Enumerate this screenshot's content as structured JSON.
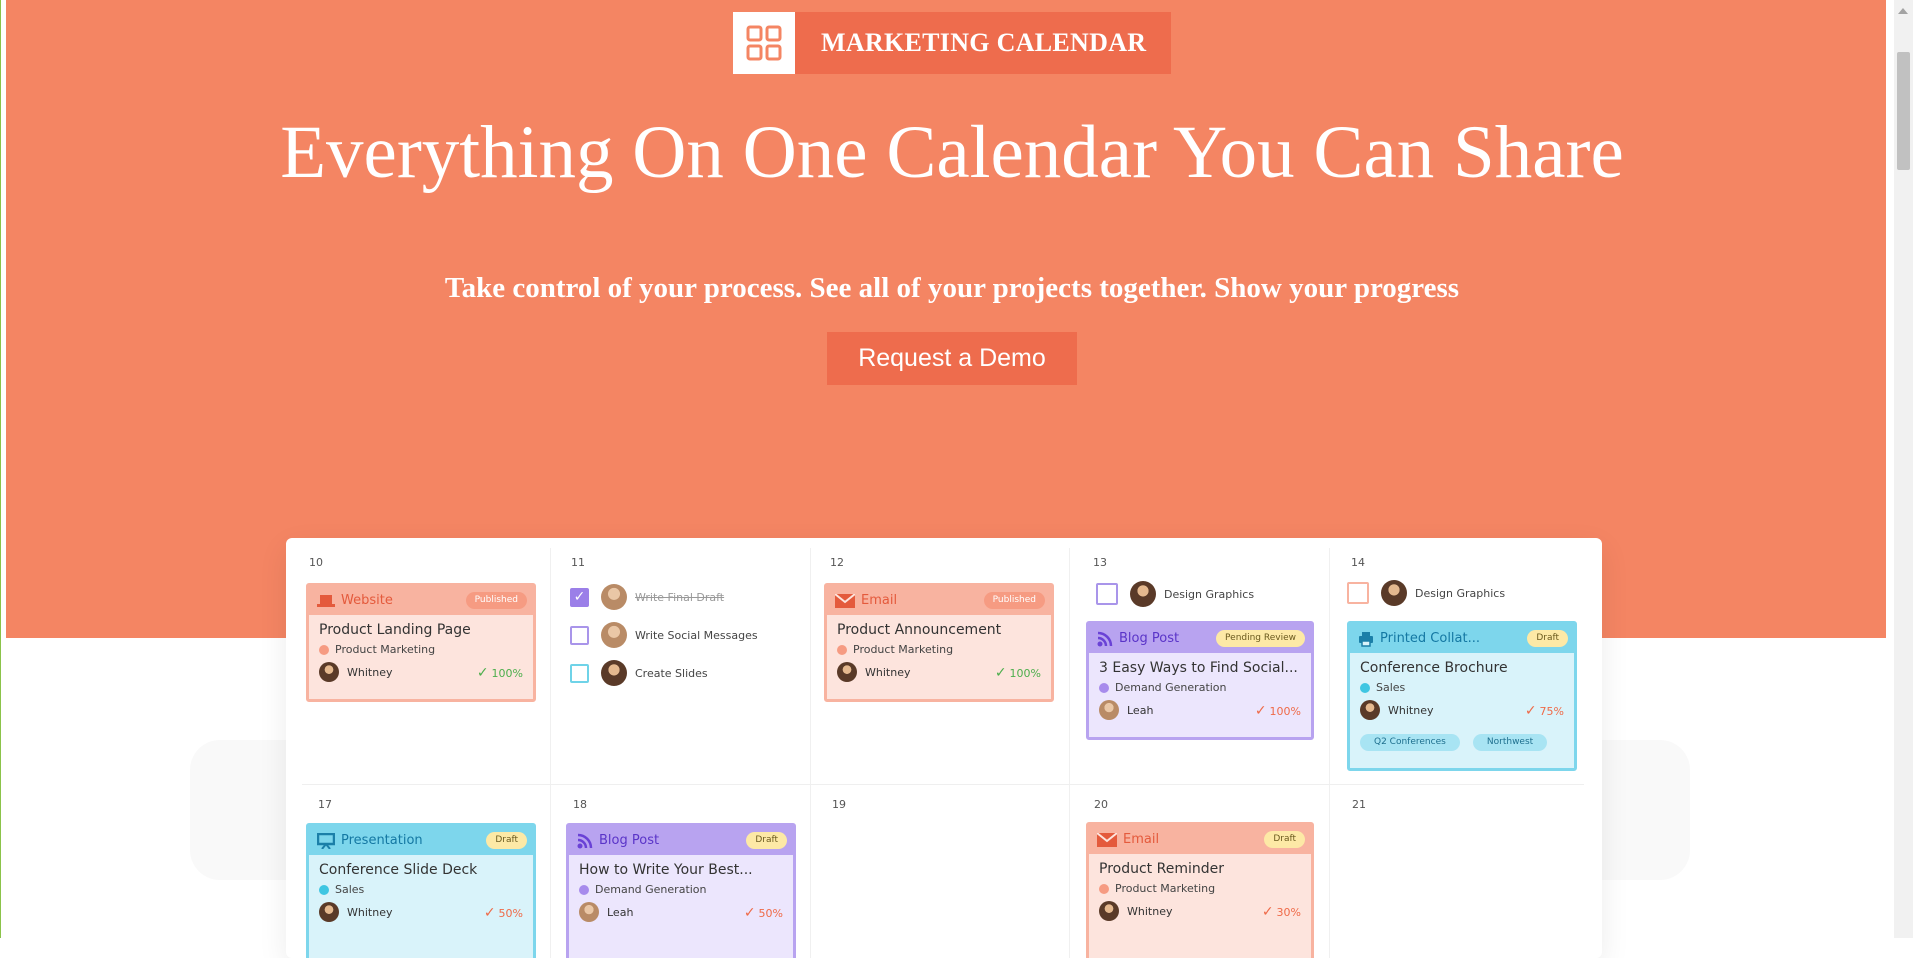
{
  "hero": {
    "brand_title": "MARKETING CALENDAR",
    "headline": "Everything On One Calendar You Can Share",
    "subhead": "Take control of your process. See all of your projects together. Show your progress",
    "cta_label": "Request a Demo"
  },
  "colors": {
    "hero_bg": "#f48563",
    "accent": "#ee6c4d",
    "website": "#f08a6f",
    "blog": "#a78bec",
    "print": "#5fcfe6",
    "success": "#4cae4c"
  },
  "calendar": {
    "days": {
      "d10": "10",
      "d11": "11",
      "d12": "12",
      "d13": "13",
      "d14": "14",
      "d17": "17",
      "d18": "18",
      "d19": "19",
      "d20": "20",
      "d21": "21"
    },
    "cards": {
      "website": {
        "type": "Website",
        "status": "Published",
        "title": "Product Landing Page",
        "category": "Product Marketing",
        "owner": "Whitney",
        "progress": "100%"
      },
      "email1": {
        "type": "Email",
        "status": "Published",
        "title": "Product Announcement",
        "category": "Product Marketing",
        "owner": "Whitney",
        "progress": "100%"
      },
      "blog1": {
        "type": "Blog Post",
        "status": "Pending Review",
        "title": "3 Easy Ways to Find Social...",
        "category": "Demand Generation",
        "owner": "Leah",
        "progress": "100%"
      },
      "print1": {
        "type": "Printed Collat...",
        "status": "Draft",
        "title": "Conference Brochure",
        "category": "Sales",
        "owner": "Whitney",
        "progress": "75%",
        "tags": [
          "Q2 Conferences",
          "Northwest"
        ]
      },
      "pres1": {
        "type": "Presentation",
        "status": "Draft",
        "title": "Conference Slide Deck",
        "category": "Sales",
        "owner": "Whitney",
        "progress": "50%"
      },
      "blog2": {
        "type": "Blog Post",
        "status": "Draft",
        "title": "How to Write Your Best...",
        "category": "Demand Generation",
        "owner": "Leah",
        "progress": "50%"
      },
      "email2": {
        "type": "Email",
        "status": "Draft",
        "title": "Product Reminder",
        "category": "Product Marketing",
        "owner": "Whitney",
        "progress": "30%"
      }
    },
    "tasks": {
      "t11a": "Write Final Draft",
      "t11b": "Write Social Messages",
      "t11c": "Create Slides",
      "t13": "Design Graphics",
      "t14": "Design Graphics"
    }
  }
}
